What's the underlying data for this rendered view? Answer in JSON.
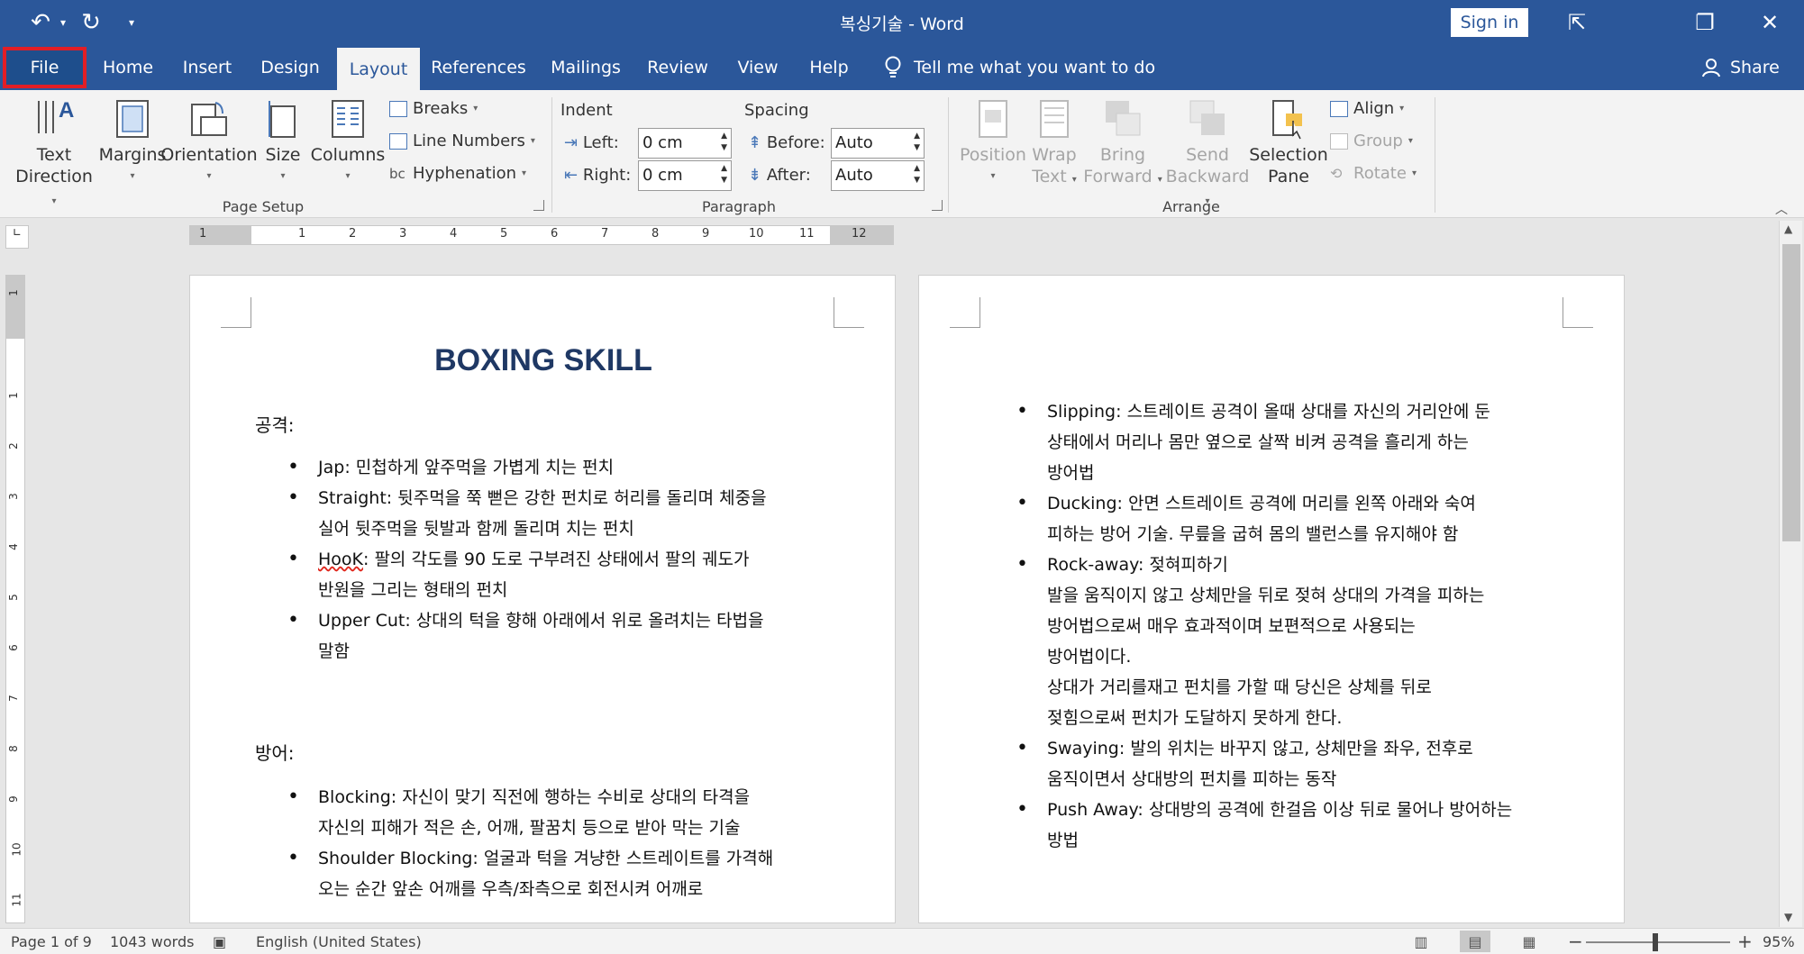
{
  "window": {
    "title": "복싱기술  -  Word",
    "sign_in": "Sign in",
    "controls": {
      "ribbon_display": "⇱",
      "restore": "❐",
      "close": "✕"
    }
  },
  "quick_access": {
    "undo": "↶",
    "dropdown": "▾",
    "redo": "↻",
    "customize": "▾"
  },
  "tabs": [
    {
      "label": "File"
    },
    {
      "label": "Home"
    },
    {
      "label": "Insert"
    },
    {
      "label": "Design"
    },
    {
      "label": "Layout"
    },
    {
      "label": "References"
    },
    {
      "label": "Mailings"
    },
    {
      "label": "Review"
    },
    {
      "label": "View"
    },
    {
      "label": "Help"
    }
  ],
  "active_tab": "Layout",
  "tell_me": "Tell me what you want to do",
  "share": "Share",
  "ribbon": {
    "page_setup": {
      "label": "Page Setup",
      "text_direction": [
        "Text",
        "Direction"
      ],
      "margins": "Margins",
      "orientation": "Orientation",
      "size": "Size",
      "columns": "Columns",
      "breaks": "Breaks",
      "line_numbers": "Line Numbers",
      "hyphenation": "Hyphenation"
    },
    "paragraph": {
      "label": "Paragraph",
      "indent": "Indent",
      "spacing": "Spacing",
      "left_label": "Left:",
      "left_value": "0 cm",
      "right_label": "Right:",
      "right_value": "0 cm",
      "before_label": "Before:",
      "before_value": "Auto",
      "after_label": "After:",
      "after_value": "Auto"
    },
    "arrange": {
      "label": "Arrange",
      "position": "Position",
      "wrap_text": [
        "Wrap",
        "Text"
      ],
      "bring_forward": [
        "Bring",
        "Forward"
      ],
      "send_backward": [
        "Send",
        "Backward"
      ],
      "selection_pane": [
        "Selection",
        "Pane"
      ],
      "align": "Align",
      "group": "Group",
      "rotate": "Rotate"
    }
  },
  "ruler": {
    "h_numbers": [
      "1",
      "1",
      "2",
      "3",
      "4",
      "5",
      "6",
      "7",
      "8",
      "9",
      "10",
      "11",
      "12"
    ],
    "v_numbers": [
      "1",
      "1",
      "2",
      "3",
      "4",
      "5",
      "6",
      "7",
      "8",
      "9",
      "10",
      "11"
    ]
  },
  "page1": {
    "heading": "BOXING SKILL",
    "attack_label": "공격:",
    "attack_items": [
      {
        "term": "Jap",
        "desc": ": 민첩하게 앞주먹을 가볍게 치는 펀치"
      },
      {
        "term": "Straight",
        "desc": ": 뒷주먹을 쭉 뻗은 강한 펀치로 허리를 돌리며 체중을",
        "cont": [
          "실어 뒷주먹을 뒷발과 함께 돌리며 치는 펀치"
        ]
      },
      {
        "term": "HooK",
        "desc": ": 팔의 각도를 90 도로 구부려진 상태에서 팔의 궤도가",
        "cont": [
          "반원을 그리는 형태의 펀치"
        ]
      },
      {
        "term": "Upper Cut",
        "desc": ": 상대의 턱을 향해 아래에서 위로 올려치는 타법을",
        "cont": [
          "말함"
        ]
      }
    ],
    "defense_label": "방어:",
    "defense_items": [
      {
        "term": "Blocking",
        "desc": ": 자신이 맞기 직전에 행하는 수비로 상대의 타격을",
        "cont": [
          "자신의 피해가 적은 손, 어깨, 팔꿈치 등으로 받아 막는 기술"
        ]
      },
      {
        "term": "Shoulder Blocking",
        "desc": ": 얼굴과 턱을 겨냥한 스트레이트를 가격해",
        "cont": [
          "오는 순간 앞손 어깨를 우측/좌측으로 회전시켜 어깨로"
        ]
      }
    ]
  },
  "page2": {
    "items": [
      {
        "term": "Slipping",
        "desc": ": 스트레이트 공격이 올때 상대를 자신의 거리안에 둔",
        "cont": [
          "상태에서 머리나 몸만 옆으로 살짝 비켜 공격을 흘리게 하는",
          "방어법"
        ]
      },
      {
        "term": "Ducking",
        "desc": ": 안면 스트레이트 공격에 머리를 왼쪽 아래와 숙여",
        "cont": [
          "피하는 방어 기술. 무릎을 굽혀 몸의 밸런스를 유지해야 함"
        ]
      },
      {
        "term": "Rock-away",
        "desc": ": 젖혀피하기",
        "cont": [
          "발을 움직이지 않고 상체만을 뒤로 젖혀 상대의 가격을 피하는",
          "방어법으로써 매우 효과적이며 보편적으로 사용되는",
          "방어법이다.",
          "상대가 거리를재고 펀치를 가할 때 당신은 상체를 뒤로",
          "젖힘으로써 펀치가 도달하지 못하게 한다."
        ]
      },
      {
        "term": "Swaying",
        "desc": ": 발의 위치는 바꾸지 않고, 상체만을 좌우, 전후로",
        "cont": [
          "움직이면서 상대방의 펀치를 피하는 동작"
        ]
      },
      {
        "term": "Push Away",
        "desc": ": 상대방의 공격에 한걸음 이상 뒤로 물어나 방어하는",
        "cont": [
          "방법"
        ]
      }
    ]
  },
  "status": {
    "page": "Page 1 of 9",
    "words": "1043 words",
    "language": "English (United States)",
    "zoom_minus": "−",
    "zoom_plus": "+",
    "zoom": "95%"
  },
  "colors": {
    "brand": "#2b579a",
    "heading": "#1f3864",
    "highlight_box": "#e21e26"
  }
}
